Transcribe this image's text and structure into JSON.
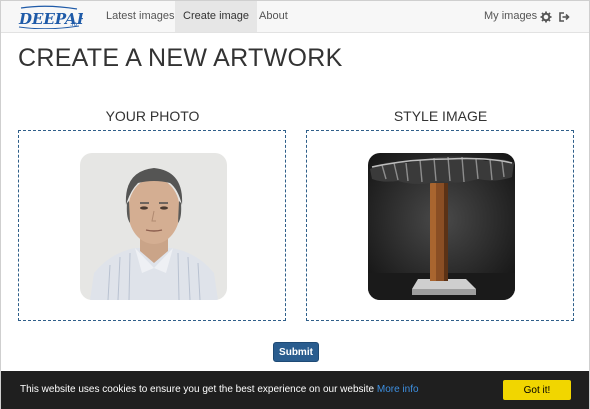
{
  "nav": {
    "logo_text": "DEEPART.io",
    "links": [
      {
        "label": "Latest images",
        "active": false
      },
      {
        "label": "Create image",
        "active": true
      },
      {
        "label": "About",
        "active": false
      }
    ],
    "my_images_label": "My images",
    "icons": [
      "gear-icon",
      "logout-icon"
    ]
  },
  "page": {
    "title": "CREATE A NEW ARTWORK"
  },
  "sections": {
    "photo": {
      "heading": "YOUR PHOTO"
    },
    "style": {
      "heading": "STYLE IMAGE"
    }
  },
  "submit_label": "Submit",
  "cookie": {
    "message": "This website uses cookies to ensure you get the best experience on our website",
    "more_info": "More info",
    "button_label": "Got it!"
  },
  "colors": {
    "accent": "#2a5d8f",
    "cookie_button": "#f1d600",
    "cookie_bar": "#1f1f1f",
    "dropzone_border": "#2f5f8a"
  }
}
